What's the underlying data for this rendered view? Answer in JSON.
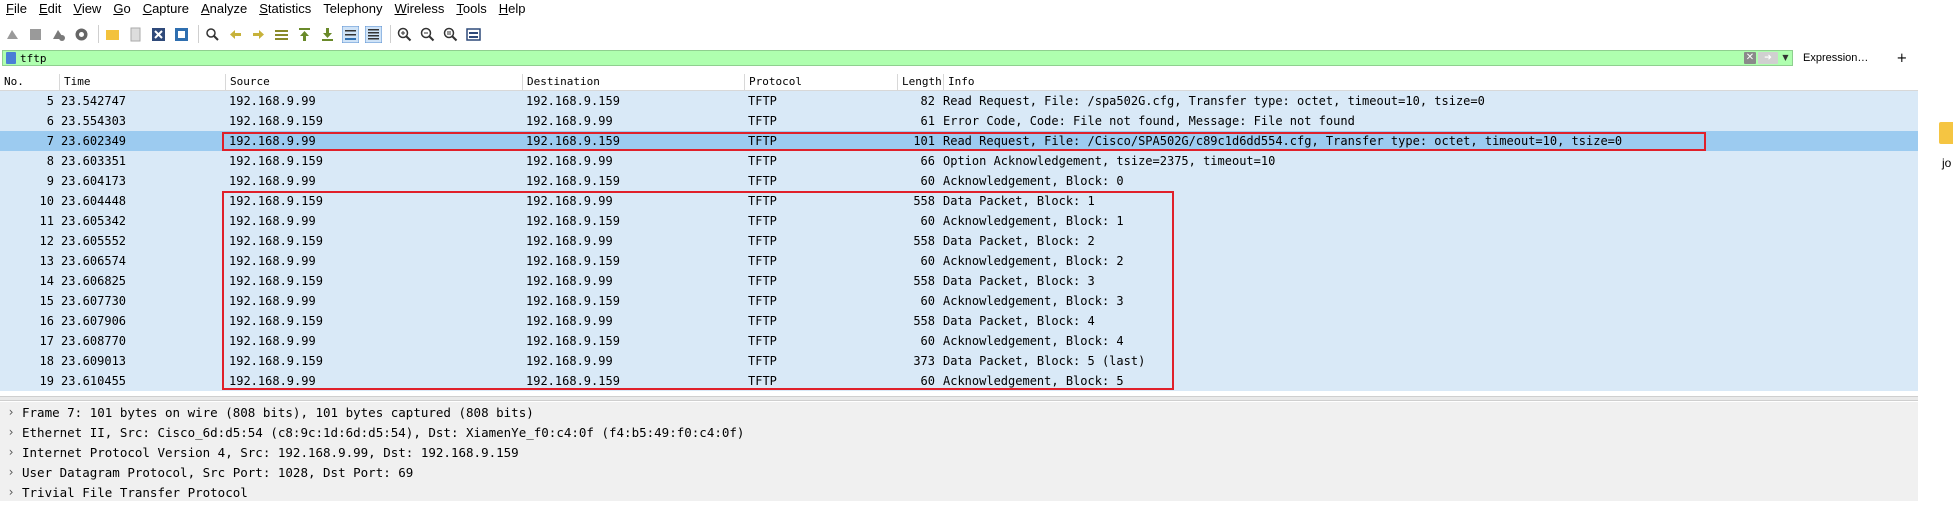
{
  "menu": [
    {
      "label": "File",
      "u": "F",
      "rest": "ile"
    },
    {
      "label": "Edit",
      "u": "E",
      "rest": "dit"
    },
    {
      "label": "View",
      "u": "V",
      "rest": "iew"
    },
    {
      "label": "Go",
      "u": "G",
      "rest": "o"
    },
    {
      "label": "Capture",
      "u": "C",
      "rest": "apture"
    },
    {
      "label": "Analyze",
      "u": "A",
      "rest": "nalyze"
    },
    {
      "label": "Statistics",
      "u": "S",
      "rest": "tatistics"
    },
    {
      "label": "Telephony",
      "u": "",
      "rest": "Telephony"
    },
    {
      "label": "Wireless",
      "u": "W",
      "rest": "ireless"
    },
    {
      "label": "Tools",
      "u": "T",
      "rest": "ools"
    },
    {
      "label": "Help",
      "u": "H",
      "rest": "elp"
    }
  ],
  "toolbar": {
    "icons": [
      "shark-start-icon",
      "stop-icon",
      "restart-icon",
      "options-gear-icon",
      "open-folder-icon",
      "file-icon",
      "close-file-icon",
      "reload-icon",
      "find-icon",
      "back-arrow-icon",
      "forward-arrow-icon",
      "go-to-packet-icon",
      "first-packet-icon",
      "last-packet-icon",
      "autoscroll-icon",
      "colorize-icon",
      "zoom-in-icon",
      "zoom-out-icon",
      "normal-size-icon",
      "resize-columns-icon"
    ]
  },
  "filter": {
    "value": "tftp",
    "expression_label": "Expression…",
    "add_label": "+"
  },
  "columns": {
    "no": "No.",
    "time": "Time",
    "source": "Source",
    "destination": "Destination",
    "protocol": "Protocol",
    "length": "Length",
    "info": "Info"
  },
  "packets": [
    {
      "no": "5",
      "time": "23.542747",
      "source": "192.168.9.99",
      "destination": "192.168.9.159",
      "protocol": "TFTP",
      "length": "82",
      "info": "Read Request, File: /spa502G.cfg, Transfer type: octet, timeout=10, tsize=0"
    },
    {
      "no": "6",
      "time": "23.554303",
      "source": "192.168.9.159",
      "destination": "192.168.9.99",
      "protocol": "TFTP",
      "length": "61",
      "info": "Error Code, Code: File not found, Message: File not found"
    },
    {
      "no": "7",
      "time": "23.602349",
      "source": "192.168.9.99",
      "destination": "192.168.9.159",
      "protocol": "TFTP",
      "length": "101",
      "info": "Read Request, File: /Cisco/SPA502G/c89c1d6dd554.cfg, Transfer type: octet, timeout=10, tsize=0",
      "selected": true
    },
    {
      "no": "8",
      "time": "23.603351",
      "source": "192.168.9.159",
      "destination": "192.168.9.99",
      "protocol": "TFTP",
      "length": "66",
      "info": "Option Acknowledgement, tsize=2375, timeout=10"
    },
    {
      "no": "9",
      "time": "23.604173",
      "source": "192.168.9.99",
      "destination": "192.168.9.159",
      "protocol": "TFTP",
      "length": "60",
      "info": "Acknowledgement, Block: 0"
    },
    {
      "no": "10",
      "time": "23.604448",
      "source": "192.168.9.159",
      "destination": "192.168.9.99",
      "protocol": "TFTP",
      "length": "558",
      "info": "Data Packet, Block: 1"
    },
    {
      "no": "11",
      "time": "23.605342",
      "source": "192.168.9.99",
      "destination": "192.168.9.159",
      "protocol": "TFTP",
      "length": "60",
      "info": "Acknowledgement, Block: 1"
    },
    {
      "no": "12",
      "time": "23.605552",
      "source": "192.168.9.159",
      "destination": "192.168.9.99",
      "protocol": "TFTP",
      "length": "558",
      "info": "Data Packet, Block: 2"
    },
    {
      "no": "13",
      "time": "23.606574",
      "source": "192.168.9.99",
      "destination": "192.168.9.159",
      "protocol": "TFTP",
      "length": "60",
      "info": "Acknowledgement, Block: 2"
    },
    {
      "no": "14",
      "time": "23.606825",
      "source": "192.168.9.159",
      "destination": "192.168.9.99",
      "protocol": "TFTP",
      "length": "558",
      "info": "Data Packet, Block: 3"
    },
    {
      "no": "15",
      "time": "23.607730",
      "source": "192.168.9.99",
      "destination": "192.168.9.159",
      "protocol": "TFTP",
      "length": "60",
      "info": "Acknowledgement, Block: 3"
    },
    {
      "no": "16",
      "time": "23.607906",
      "source": "192.168.9.159",
      "destination": "192.168.9.99",
      "protocol": "TFTP",
      "length": "558",
      "info": "Data Packet, Block: 4"
    },
    {
      "no": "17",
      "time": "23.608770",
      "source": "192.168.9.99",
      "destination": "192.168.9.159",
      "protocol": "TFTP",
      "length": "60",
      "info": "Acknowledgement, Block: 4"
    },
    {
      "no": "18",
      "time": "23.609013",
      "source": "192.168.9.159",
      "destination": "192.168.9.99",
      "protocol": "TFTP",
      "length": "373",
      "info": "Data Packet, Block: 5 (last)"
    },
    {
      "no": "19",
      "time": "23.610455",
      "source": "192.168.9.99",
      "destination": "192.168.9.159",
      "protocol": "TFTP",
      "length": "60",
      "info": "Acknowledgement, Block: 5"
    }
  ],
  "details": [
    "Frame 7: 101 bytes on wire (808 bits), 101 bytes captured (808 bits)",
    "Ethernet II, Src: Cisco_6d:d5:54 (c8:9c:1d:6d:d5:54), Dst: XiamenYe_f0:c4:0f (f4:b5:49:f0:c4:0f)",
    "Internet Protocol Version 4, Src: 192.168.9.99, Dst: 192.168.9.159",
    "User Datagram Protocol, Src Port: 1028, Dst Port: 69",
    "Trivial File Transfer Protocol"
  ],
  "edge_text": "jo",
  "colors": {
    "row_bg": "#d9e9f7",
    "selected_bg": "#9ccbf0",
    "filter_bg": "#afffaf",
    "highlight": "#e0202a",
    "details_bg": "#f0f0f0"
  }
}
